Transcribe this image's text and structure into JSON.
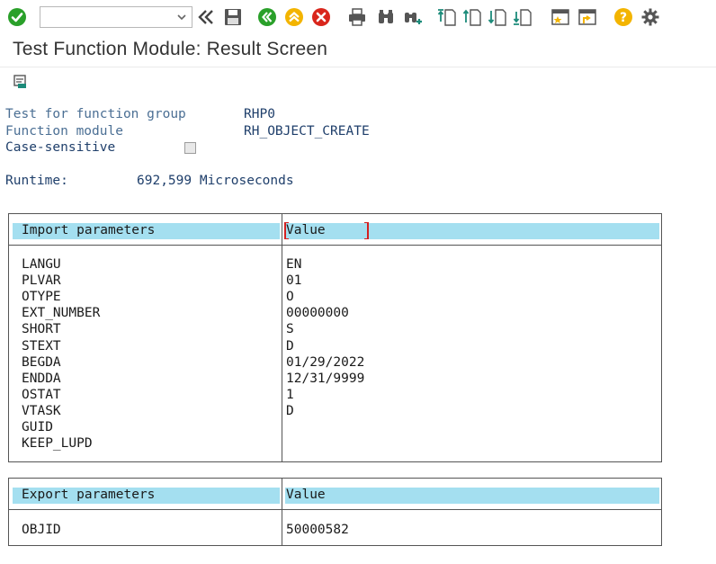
{
  "toolbar": {
    "command_value": "",
    "icons": [
      "enter-check-icon",
      "back-double-chevron-icon",
      "save-icon",
      "back-green-icon",
      "exit-up-icon",
      "cancel-red-icon",
      "print-icon",
      "find-icon",
      "find-next-icon",
      "first-page-icon",
      "previous-page-icon",
      "next-page-icon",
      "last-page-icon",
      "new-session-icon",
      "create-shortcut-icon",
      "help-icon",
      "settings-gear-icon"
    ],
    "colors": {
      "green": "#2aa02a",
      "yellow": "#f3b400",
      "red": "#d9261c",
      "gray": "#555555",
      "teal": "#1c8b7a"
    }
  },
  "title": "Test Function Module: Result Screen",
  "info": {
    "function_group_label": "Test for function group",
    "function_group_value": "RHP0",
    "function_module_label": "Function module",
    "function_module_value": "RH_OBJECT_CREATE",
    "case_sensitive_label": "Case-sensitive",
    "case_sensitive_checked": false,
    "runtime_label": "Runtime:",
    "runtime_value": "692,599 Microseconds"
  },
  "import_table": {
    "header_param": "Import parameters",
    "header_value": "Value",
    "rows": [
      {
        "param": "LANGU",
        "value": "EN"
      },
      {
        "param": "PLVAR",
        "value": "01"
      },
      {
        "param": "OTYPE",
        "value": "O"
      },
      {
        "param": "EXT_NUMBER",
        "value": "00000000"
      },
      {
        "param": "SHORT",
        "value": "S"
      },
      {
        "param": "STEXT",
        "value": "D"
      },
      {
        "param": "BEGDA",
        "value": "01/29/2022"
      },
      {
        "param": "ENDDA",
        "value": "12/31/9999"
      },
      {
        "param": "OSTAT",
        "value": "1"
      },
      {
        "param": "VTASK",
        "value": "D"
      },
      {
        "param": "GUID",
        "value": ""
      },
      {
        "param": "KEEP_LUPD",
        "value": ""
      }
    ]
  },
  "export_table": {
    "header_param": "Export parameters",
    "header_value": "Value",
    "rows": [
      {
        "param": "OBJID",
        "value": "50000582"
      }
    ]
  },
  "colors": {
    "header_bar": "#a4dff0",
    "label_blue": "#4b6f94",
    "value_blue": "#1f3f6b"
  }
}
